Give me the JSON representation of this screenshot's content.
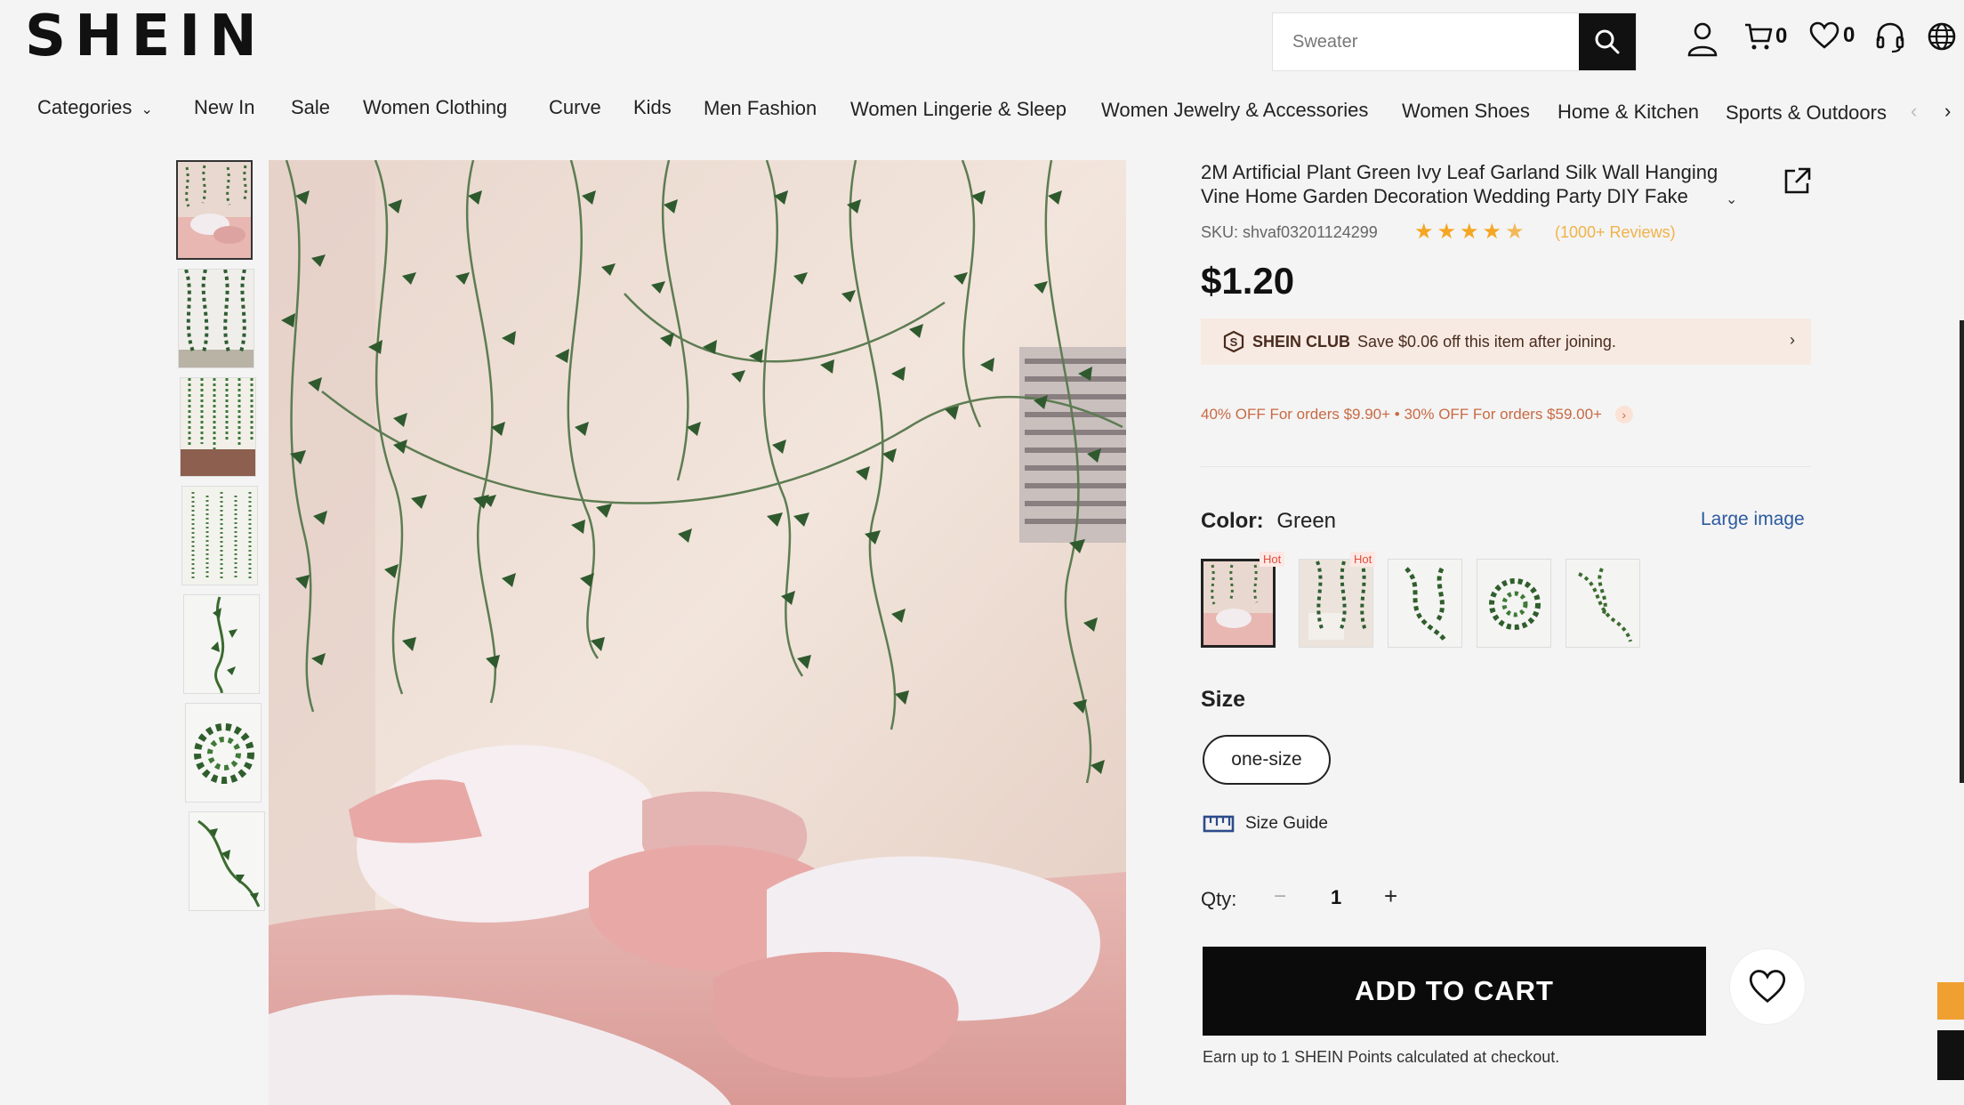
{
  "header": {
    "logo": "SHEIN",
    "search_placeholder": "Sweater",
    "cart_count": "0",
    "wishlist_count": "0"
  },
  "nav": {
    "items": [
      "Categories",
      "New In",
      "Sale",
      "Women Clothing",
      "Curve",
      "Kids",
      "Men Fashion",
      "Women Lingerie & Sleep",
      "Women Jewelry & Accessories",
      "Women Shoes",
      "Home & Kitchen",
      "Sports & Outdoors"
    ]
  },
  "product": {
    "title": "2M Artificial Plant Green Ivy Leaf Garland Silk Wall Hanging Vine Home Garden Decoration Wedding Party DIY Fake",
    "sku": "SKU: shvaf03201124299",
    "rating": 4.5,
    "reviews": "(1000+ Reviews)",
    "price": "$1.20",
    "club": {
      "name": "SHEIN CLUB",
      "text": "Save $0.06 off this item after joining."
    },
    "promo": "40% OFF For orders $9.90+ •  30% OFF For orders $59.00+",
    "color_label": "Color:",
    "color_value": "Green",
    "large_image": "Large image",
    "swatches": [
      {
        "hot": "Hot"
      },
      {
        "hot": "Hot"
      },
      {
        "hot": ""
      },
      {
        "hot": ""
      },
      {
        "hot": ""
      }
    ],
    "size_label": "Size",
    "size_option": "one-size",
    "size_guide": "Size Guide",
    "qty_label": "Qty:",
    "qty_minus": "−",
    "qty_value": "1",
    "qty_plus": "+",
    "add_to_cart": "ADD TO CART",
    "points_note": "Earn up to 1 SHEIN Points calculated at checkout."
  },
  "colors": {
    "accent_star": "#f5a623",
    "club_bg": "#f7eae3",
    "promo_text": "#c86a44",
    "link_blue": "#2c5aa0",
    "hot_red": "#e24c3c"
  }
}
